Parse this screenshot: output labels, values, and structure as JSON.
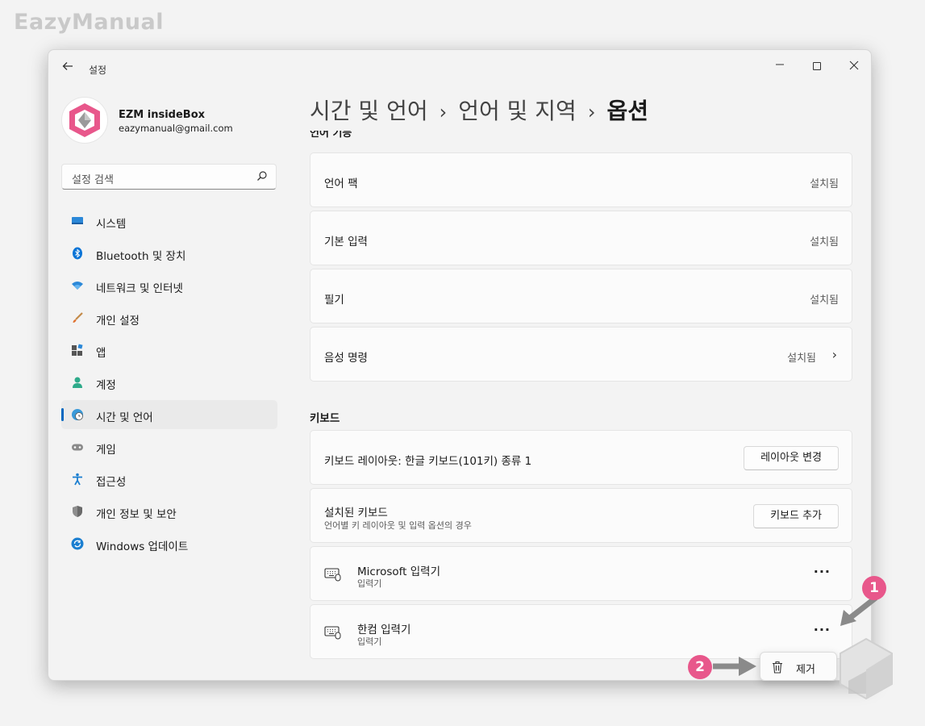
{
  "watermark": "EazyManual",
  "window": {
    "title": "설정",
    "controls": {
      "minimize": "—",
      "close": "✕"
    }
  },
  "profile": {
    "name": "EZM insideBox",
    "email": "eazymanual@gmail.com"
  },
  "search": {
    "placeholder": "설정 검색"
  },
  "nav": [
    {
      "label": "시스템",
      "icon": "system-icon",
      "active": false
    },
    {
      "label": "Bluetooth 및 장치",
      "icon": "bluetooth-icon",
      "active": false
    },
    {
      "label": "네트워크 및 인터넷",
      "icon": "wifi-icon",
      "active": false
    },
    {
      "label": "개인 설정",
      "icon": "brush-icon",
      "active": false
    },
    {
      "label": "앱",
      "icon": "apps-icon",
      "active": false
    },
    {
      "label": "계정",
      "icon": "account-icon",
      "active": false
    },
    {
      "label": "시간 및 언어",
      "icon": "time-language-icon",
      "active": true
    },
    {
      "label": "게임",
      "icon": "gamepad-icon",
      "active": false
    },
    {
      "label": "접근성",
      "icon": "accessibility-icon",
      "active": false
    },
    {
      "label": "개인 정보 및 보안",
      "icon": "shield-icon",
      "active": false
    },
    {
      "label": "Windows 업데이트",
      "icon": "update-icon",
      "active": false
    }
  ],
  "breadcrumb": {
    "level1": "시간 및 언어",
    "level2": "언어 및 지역",
    "current": "옵션",
    "separator": "›"
  },
  "language_features": {
    "section_title": "언어 기능",
    "items": [
      {
        "title": "언어 팩",
        "status": "설치됨"
      },
      {
        "title": "기본 입력",
        "status": "설치됨"
      },
      {
        "title": "필기",
        "status": "설치됨"
      },
      {
        "title": "음성 명령",
        "status": "설치됨",
        "chevron": "›"
      }
    ]
  },
  "keyboard": {
    "section_title": "키보드",
    "layout_label": "키보드 레이아웃: 한글 키보드(101키) 종류 1",
    "layout_button": "레이아웃 변경",
    "installed_title": "설치된 키보드",
    "installed_sub": "언어별 키 레이아웃 및 입력 옵션의 경우",
    "add_button": "키보드 추가",
    "keyboards": [
      {
        "name": "Microsoft 입력기",
        "type": "입력기",
        "more": "···"
      },
      {
        "name": "한컴 입력기",
        "type": "입력기",
        "more": "···"
      }
    ]
  },
  "flyout": {
    "remove_label": "제거"
  },
  "markers": [
    "1",
    "2"
  ],
  "colors": {
    "accent": "#0067c0",
    "marker": "#e8578b",
    "arrow": "#8a8a8a"
  }
}
